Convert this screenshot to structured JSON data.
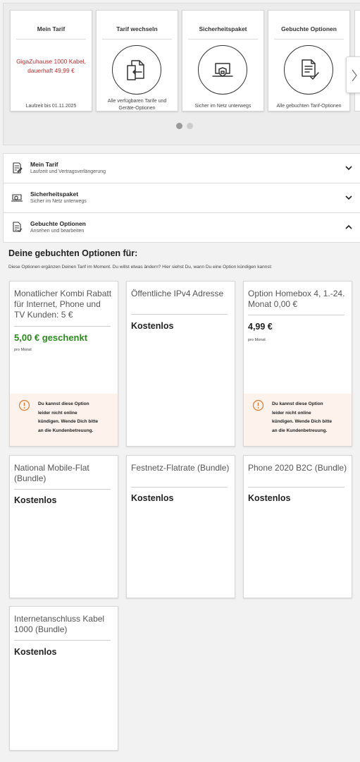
{
  "carousel": {
    "cards": [
      {
        "title": "Mein Tarif",
        "tarif": "GigaZuhause 1000 Kabel, dauerhaft 49,99 €",
        "footer": "Laufzeit bis 01.11.2025",
        "icon": "none"
      },
      {
        "title": "Tarif wechseln",
        "footer": "Alle verfügbaren Tarife und Geräte-Optionen",
        "icon": "tariff-switch-icon"
      },
      {
        "title": "Sicherheitspaket",
        "footer": "Sicher im Netz unterwegs",
        "icon": "secure-laptop-icon"
      },
      {
        "title": "Gebuchte Optionen",
        "footer": "Alle gebuchten Tarif-Optionen",
        "icon": "checklist-icon"
      }
    ],
    "next_icon": "chevron-right-icon",
    "pagination": {
      "pages": 2,
      "active": 1
    }
  },
  "accordion": {
    "items": [
      {
        "title": "Mein Tarif",
        "subtitle": "Laufzeit und Vertragsverlängerung",
        "icon": "contract-icon",
        "expanded": false
      },
      {
        "title": "Sicherheitspaket",
        "subtitle": "Sicher im Netz unterwegs",
        "icon": "secure-laptop-icon",
        "expanded": false
      },
      {
        "title": "Gebuchte Optionen",
        "subtitle": "Ansehen und bearbeiten",
        "icon": "checklist-icon",
        "expanded": true
      }
    ]
  },
  "options": {
    "heading": "Deine gebuchten Optionen für:",
    "intro": "Diese Optionen ergänzen Deinen Tarif im Moment. Du willst etwas ändern? Hier siehst Du, wann Du eine Option kündigen kannst:",
    "items": [
      {
        "title": "Monatlicher Kombi Rabatt für Internet, Phone und TV Kunden: 5 €",
        "price": "5,00 € geschenkt",
        "period": "pro Monat",
        "warning": "Du kannst diese Option leider nicht online kündigen. Wende Dich bitte an die Kundenbetreuung."
      },
      {
        "title": "Öffentliche IPv4 Adresse",
        "price": "Kostenlos"
      },
      {
        "title": "Option Homebox 4, 1.-24. Monat 0,00 €",
        "price": "4,99 €",
        "period": "pro Monat",
        "warning": "Du kannst diese Option leider nicht online kündigen. Wende Dich bitte an die Kundenbetreuung."
      },
      {
        "title": "National Mobile-Flat (Bundle)",
        "price": "Kostenlos"
      },
      {
        "title": "Festnetz-Flatrate (Bundle)",
        "price": "Kostenlos"
      },
      {
        "title": "Phone 2020 B2C (Bundle)",
        "price": "Kostenlos"
      },
      {
        "title": "Internetanschluss Kabel 1000 (Bundle)",
        "price": "Kostenlos"
      }
    ]
  },
  "colors": {
    "accent_red": "#b52e2e",
    "discount_green": "#2b8a1d",
    "warning_bg": "#fdf3ec",
    "warning_icon": "#e07a2e"
  }
}
